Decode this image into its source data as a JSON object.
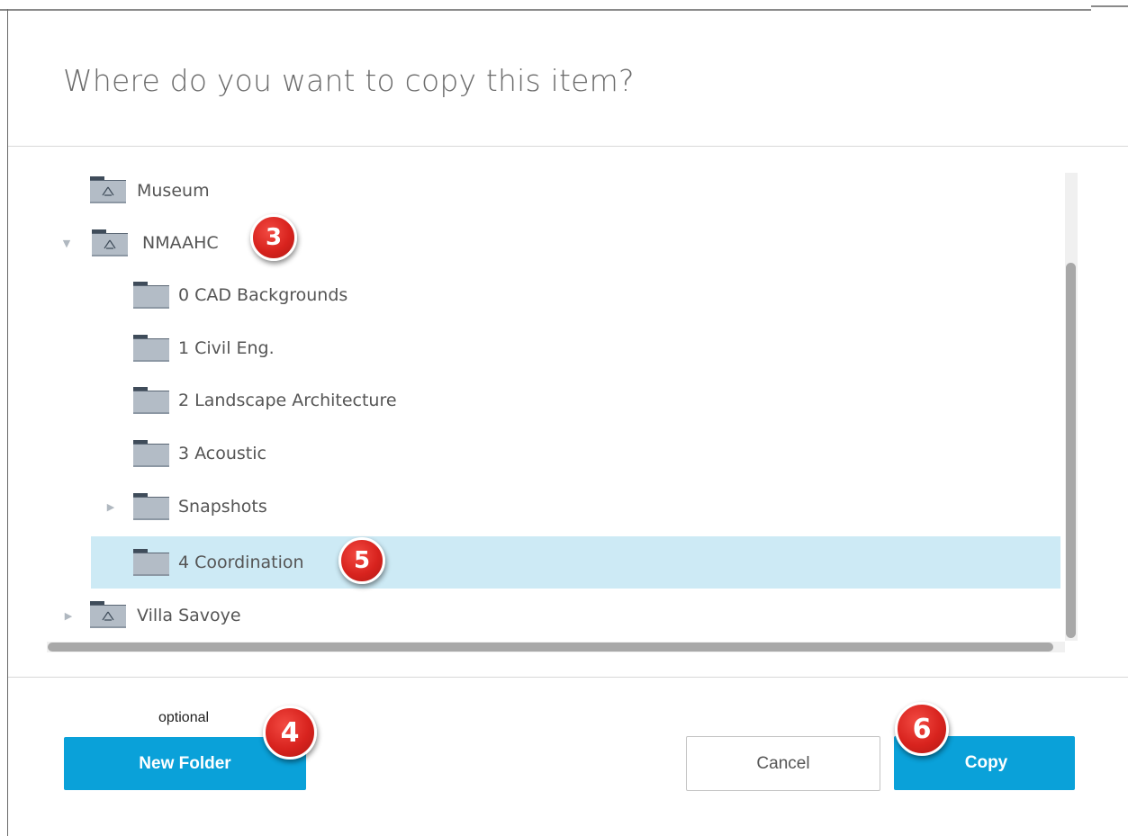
{
  "dialog": {
    "title": "Where do you want to copy this item?"
  },
  "tree": {
    "items": [
      {
        "label": "Museum",
        "type": "project",
        "expanded": null,
        "selected": false
      },
      {
        "label": "NMAAHC",
        "type": "project",
        "expanded": true,
        "selected": false
      },
      {
        "label": "0 CAD Backgrounds",
        "type": "folder",
        "expanded": null,
        "selected": false
      },
      {
        "label": "1 Civil Eng.",
        "type": "folder",
        "expanded": null,
        "selected": false
      },
      {
        "label": "2 Landscape Architecture",
        "type": "folder",
        "expanded": null,
        "selected": false
      },
      {
        "label": "3 Acoustic",
        "type": "folder",
        "expanded": null,
        "selected": false
      },
      {
        "label": "Snapshots",
        "type": "folder",
        "expanded": false,
        "selected": false
      },
      {
        "label": "4 Coordination",
        "type": "folder",
        "expanded": null,
        "selected": true
      },
      {
        "label": "Villa Savoye",
        "type": "project",
        "expanded": false,
        "selected": false
      }
    ]
  },
  "footer": {
    "optional_label": "optional",
    "new_folder_label": "New Folder",
    "cancel_label": "Cancel",
    "copy_label": "Copy"
  },
  "callouts": {
    "step3": "3",
    "step4": "4",
    "step5": "5",
    "step6": "6"
  },
  "colors": {
    "primary_button": "#0aa1d9",
    "selected_row": "#cdeaf5",
    "callout_badge": "#d8231e"
  },
  "icons": {
    "project": "project-folder-icon",
    "folder": "folder-icon",
    "expanded": "caret-down-icon",
    "collapsed": "caret-right-icon"
  }
}
